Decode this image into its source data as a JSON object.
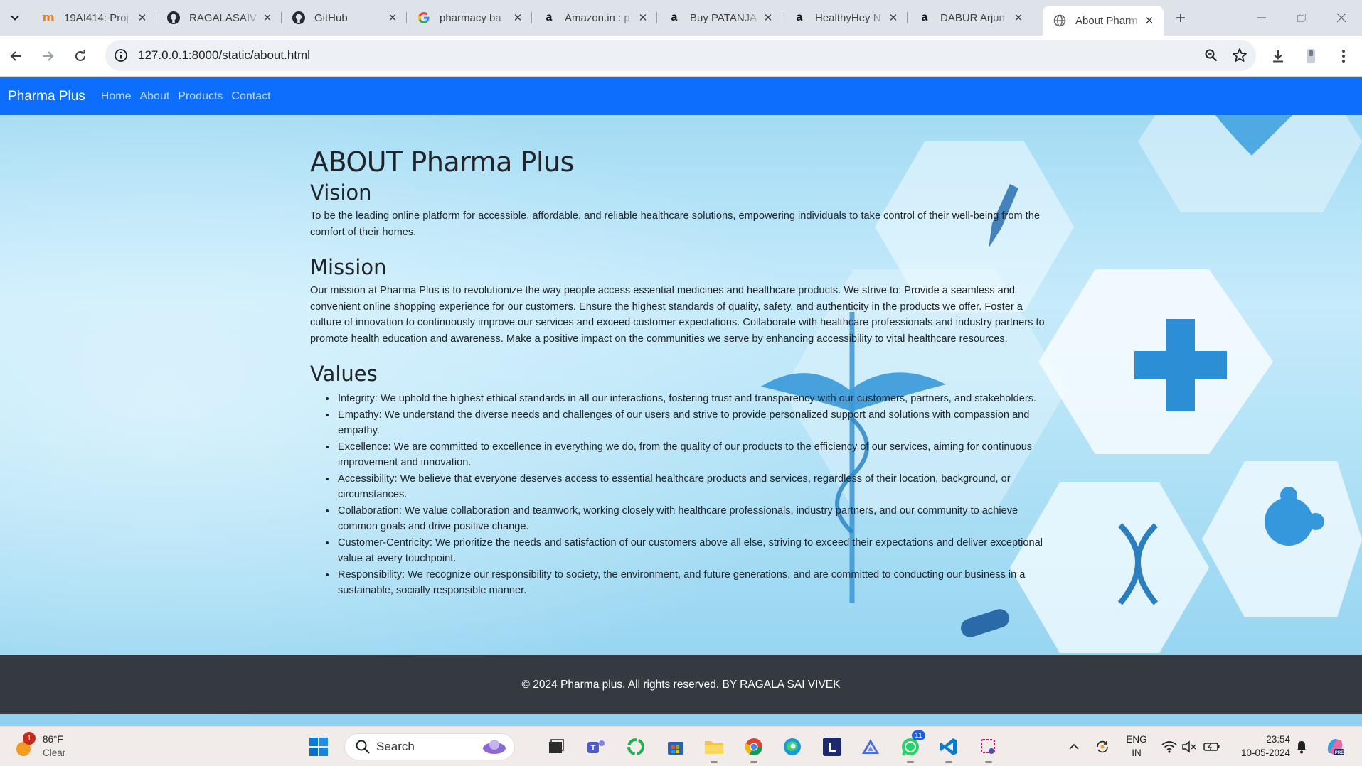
{
  "browser": {
    "tabs": [
      {
        "title": "19AI414: Proj",
        "favicon": "moodle-icon"
      },
      {
        "title": "RAGALASAIV",
        "favicon": "github-icon"
      },
      {
        "title": "GitHub",
        "favicon": "github-icon"
      },
      {
        "title": "pharmacy ba",
        "favicon": "google-icon"
      },
      {
        "title": "Amazon.in : p",
        "favicon": "amazon-icon"
      },
      {
        "title": "Buy PATANJA",
        "favicon": "amazon-icon"
      },
      {
        "title": "HealthyHey N",
        "favicon": "amazon-icon"
      },
      {
        "title": "DABUR Arjun",
        "favicon": "amazon-icon"
      },
      {
        "title": "About Pharm",
        "favicon": "globe-icon",
        "active": true
      }
    ],
    "url": "127.0.0.1:8000/static/about.html"
  },
  "page": {
    "brand": "Pharma Plus",
    "nav": [
      "Home",
      "About",
      "Products",
      "Contact"
    ],
    "title": "ABOUT Pharma Plus",
    "vision_heading": "Vision",
    "vision_text": "To be the leading online platform for accessible, affordable, and reliable healthcare solutions, empowering individuals to take control of their well-being from the comfort of their homes.",
    "mission_heading": "Mission",
    "mission_text": "Our mission at Pharma Plus is to revolutionize the way people access essential medicines and healthcare products. We strive to: Provide a seamless and convenient online shopping experience for our customers. Ensure the highest standards of quality, safety, and authenticity in the products we offer. Foster a culture of innovation to continuously improve our services and exceed customer expectations. Collaborate with healthcare professionals and industry partners to promote health education and awareness. Make a positive impact on the communities we serve by enhancing accessibility to vital healthcare resources.",
    "values_heading": "Values",
    "values": [
      "Integrity: We uphold the highest ethical standards in all our interactions, fostering trust and transparency with our customers, partners, and stakeholders.",
      "Empathy: We understand the diverse needs and challenges of our users and strive to provide personalized support and solutions with compassion and empathy.",
      "Excellence: We are committed to excellence in everything we do, from the quality of our products to the efficiency of our services, aiming for continuous improvement and innovation.",
      "Accessibility: We believe that everyone deserves access to essential healthcare products and services, regardless of their location, background, or circumstances.",
      "Collaboration: We value collaboration and teamwork, working closely with healthcare professionals, industry partners, and our community to achieve common goals and drive positive change.",
      "Customer-Centricity: We prioritize the needs and satisfaction of our customers above all else, striving to exceed their expectations and deliver exceptional value at every touchpoint.",
      "Responsibility: We recognize our responsibility to society, the environment, and future generations, and are committed to conducting our business in a sustainable, socially responsible manner."
    ],
    "footer": "© 2024 Pharma plus. All rights reserved. BY RAGALA SAI VIVEK",
    "colors": {
      "navbar": "#0d6efd",
      "footer": "#343a40",
      "text": "#212529"
    }
  },
  "taskbar": {
    "weather": {
      "temp": "86°F",
      "condition": "Clear",
      "badge": "1"
    },
    "search_placeholder": "Search",
    "whatsapp_badge": "11",
    "lang_line1": "ENG",
    "lang_line2": "IN",
    "time": "23:54",
    "date": "10-05-2024"
  }
}
